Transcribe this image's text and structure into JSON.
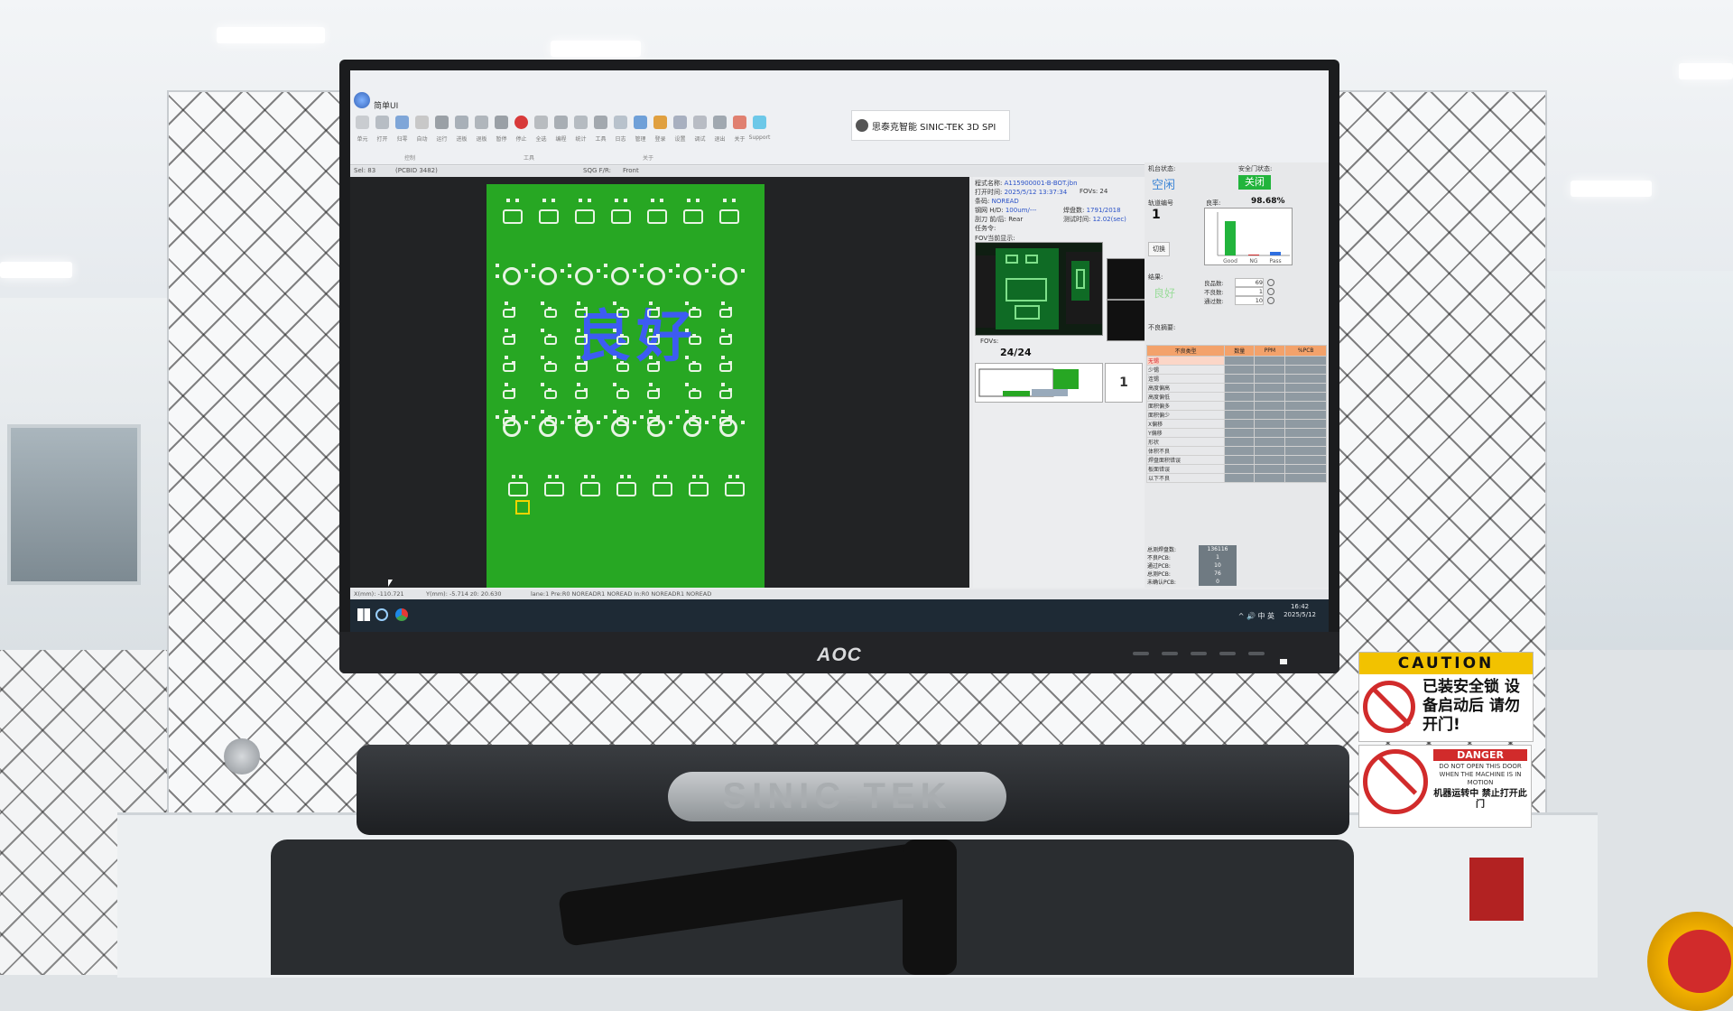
{
  "app": {
    "ribbon_tab": "简单UI",
    "brand_text": "思泰克智能 SINIC-TEK 3D SPI",
    "tools": [
      {
        "label": "单元",
        "icon": "grid-icon"
      },
      {
        "label": "打开",
        "icon": "folder-icon"
      },
      {
        "label": "归零",
        "icon": "home-icon"
      },
      {
        "label": "自动",
        "icon": "auto-icon"
      },
      {
        "label": "运行",
        "icon": "play-icon"
      },
      {
        "label": "进板",
        "icon": "board-in-icon"
      },
      {
        "label": "退板",
        "icon": "board-out-icon"
      },
      {
        "label": "暂停",
        "icon": "pause-icon"
      },
      {
        "label": "停止",
        "icon": "stop-icon"
      },
      {
        "label": "全选",
        "icon": "select-icon"
      },
      {
        "label": "编程",
        "icon": "program-icon"
      },
      {
        "label": "统计",
        "icon": "stats-icon"
      },
      {
        "label": "工具",
        "icon": "tool-icon"
      },
      {
        "label": "日志",
        "icon": "clock-icon"
      },
      {
        "label": "管理",
        "icon": "users-icon"
      },
      {
        "label": "登录",
        "icon": "user-icon"
      },
      {
        "label": "设置",
        "icon": "link-icon"
      },
      {
        "label": "调试",
        "icon": "debug-icon"
      },
      {
        "label": "退出",
        "icon": "exit-icon"
      },
      {
        "label": "关于",
        "icon": "about-icon"
      },
      {
        "label": "Support",
        "icon": "support-icon"
      }
    ],
    "ribbon_groups": [
      "控制",
      "工具",
      "关于"
    ],
    "info_left": "Sel: 83",
    "info_pos": "(PCBID 3482)",
    "info_side_label": "SQG F/R:",
    "info_side": "Front"
  },
  "inspection": {
    "result_overlay": "良好",
    "program_label": "程式名称:",
    "program_value": "A115900001-B-BOT.jbn",
    "open_time_label": "打开时间:",
    "open_time_value": "2025/5/12 13:37:34",
    "fovs_top": "FOVs: 24",
    "barcode_label": "条码:",
    "barcode_value": "NOREAD",
    "stencil_label": "钢网 H/D:",
    "stencil_value": "100um/---",
    "pads_label": "焊盘数:",
    "pads_value": "1791/2018",
    "blade_label": "刮刀 前/后:",
    "blade_value": "Rear",
    "test_time_label": "测试时间:",
    "test_time_value": "12.02(sec)",
    "task_label": "任务令:",
    "fov_display_label": "FOV当前显示:",
    "fovs_label": "FOVs:",
    "fovs_count": "24/24",
    "board_number": "1"
  },
  "status": {
    "machine_state_label": "机台状态:",
    "machine_state": "空闲",
    "door_label": "安全门状态:",
    "door_state": "关闭",
    "lane_label": "轨道编号",
    "lane_number": "1",
    "yield_label": "良率:",
    "yield_value": "98.68%",
    "result_label": "结果:",
    "result_value": "良好",
    "counts": [
      {
        "label": "良品数:",
        "value": "69"
      },
      {
        "label": "不良数:",
        "value": "1"
      },
      {
        "label": "通过数:",
        "value": "10"
      }
    ],
    "defect_header": "不良摘要:",
    "defect_columns": [
      "不良类型",
      "数量",
      "PPM",
      "%PCB"
    ],
    "defects": [
      "无锡",
      "少锡",
      "连锡",
      "高度偏高",
      "高度偏低",
      "面积偏多",
      "面积偏少",
      "X偏移",
      "Y偏移",
      "形状",
      "体积不良",
      "焊盘面积错误",
      "板面错误",
      "以下不良"
    ],
    "summary": [
      {
        "label": "总测焊盘数:",
        "value": "136116"
      },
      {
        "label": "不良PCB:",
        "value": "1"
      },
      {
        "label": "通过PCB:",
        "value": "10"
      },
      {
        "label": "总测PCB:",
        "value": "76"
      },
      {
        "label": "未确认PCB:",
        "value": "0"
      }
    ],
    "chart_labels": [
      "Good",
      "NG",
      "Pass"
    ]
  },
  "statusline": {
    "x": "X(mm): -110.721",
    "y": "Y(mm): -5.714  z0: 20.630",
    "rest": "lane:1 Pre:R0  NOREADR1  NOREAD  In:R0  NOREADR1  NOREAD"
  },
  "taskbar": {
    "tray": "^ 🔊 中 英",
    "time": "16:42",
    "date": "2025/5/12"
  },
  "machine": {
    "brand": "AOC",
    "plate": "SINIC-TEK",
    "caution_head": "CAUTION",
    "caution_text": "已装安全锁 设备启动后 请勿开门!",
    "danger_head": "DANGER",
    "danger_text": "DO NOT OPEN THIS DOOR WHEN THE MACHINE IS IN MOTION",
    "danger_text_cn": "机器运转中 禁止打开此门"
  },
  "colors": {
    "pcb": "#27a723",
    "overlay_text": "#3d5cf2",
    "door_ok": "#22b43c",
    "header_orange": "#f3a26b"
  }
}
